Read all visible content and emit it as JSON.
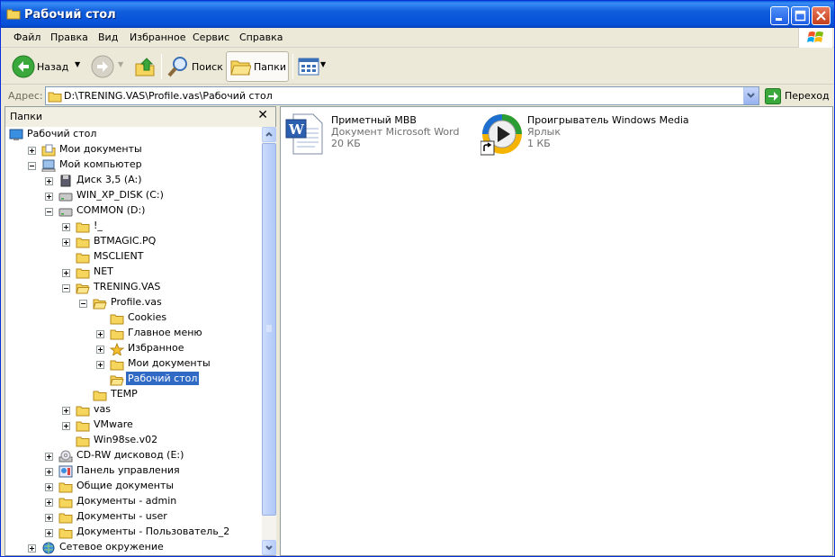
{
  "window": {
    "title": "Рабочий стол"
  },
  "menu": [
    "Файл",
    "Правка",
    "Вид",
    "Избранное",
    "Сервис",
    "Справка"
  ],
  "toolbar": {
    "back": "Назад",
    "search": "Поиск",
    "folders": "Папки"
  },
  "address": {
    "label": "Адрес:",
    "value": "D:\\TRENING.VAS\\Profile.vas\\Рабочий стол",
    "go": "Переход"
  },
  "folders_pane": {
    "title": "Папки"
  },
  "tree": [
    {
      "label": "Рабочий стол",
      "icon": "desktop-icon",
      "level": 0,
      "toggle": "none"
    },
    {
      "label": "Мои документы",
      "icon": "my-documents-icon",
      "level": 1,
      "toggle": "plus"
    },
    {
      "label": "Мой компьютер",
      "icon": "my-computer-icon",
      "level": 1,
      "toggle": "minus"
    },
    {
      "label": "Диск 3,5 (A:)",
      "icon": "floppy-icon",
      "level": 2,
      "toggle": "plus"
    },
    {
      "label": "WIN_XP_DISK (C:)",
      "icon": "drive-icon",
      "level": 2,
      "toggle": "plus"
    },
    {
      "label": "COMMON (D:)",
      "icon": "drive-icon",
      "level": 2,
      "toggle": "minus"
    },
    {
      "label": "!_",
      "icon": "folder-icon",
      "level": 3,
      "toggle": "plus"
    },
    {
      "label": "BTMAGIC.PQ",
      "icon": "folder-icon",
      "level": 3,
      "toggle": "plus"
    },
    {
      "label": "MSCLIENT",
      "icon": "folder-icon",
      "level": 3,
      "toggle": "none"
    },
    {
      "label": "NET",
      "icon": "folder-icon",
      "level": 3,
      "toggle": "plus"
    },
    {
      "label": "TRENING.VAS",
      "icon": "folder-open-icon",
      "level": 3,
      "toggle": "minus"
    },
    {
      "label": "Profile.vas",
      "icon": "folder-open-icon",
      "level": 4,
      "toggle": "minus"
    },
    {
      "label": "Cookies",
      "icon": "folder-icon",
      "level": 5,
      "toggle": "none"
    },
    {
      "label": "Главное меню",
      "icon": "folder-icon",
      "level": 5,
      "toggle": "plus"
    },
    {
      "label": "Избранное",
      "icon": "star-icon",
      "level": 5,
      "toggle": "plus"
    },
    {
      "label": "Мои документы",
      "icon": "folder-icon",
      "level": 5,
      "toggle": "plus"
    },
    {
      "label": "Рабочий стол",
      "icon": "folder-open-icon",
      "level": 5,
      "toggle": "none",
      "selected": true
    },
    {
      "label": "TEMP",
      "icon": "folder-icon",
      "level": 4,
      "toggle": "none"
    },
    {
      "label": "vas",
      "icon": "folder-icon",
      "level": 3,
      "toggle": "plus"
    },
    {
      "label": "VMware",
      "icon": "folder-icon",
      "level": 3,
      "toggle": "plus"
    },
    {
      "label": "Win98se.v02",
      "icon": "folder-icon",
      "level": 3,
      "toggle": "none"
    },
    {
      "label": "CD-RW дисковод (E:)",
      "icon": "cdrom-icon",
      "level": 2,
      "toggle": "plus"
    },
    {
      "label": "Панель управления",
      "icon": "control-panel-icon",
      "level": 2,
      "toggle": "plus"
    },
    {
      "label": "Общие документы",
      "icon": "folder-icon",
      "level": 2,
      "toggle": "plus"
    },
    {
      "label": "Документы - admin",
      "icon": "folder-icon",
      "level": 2,
      "toggle": "plus"
    },
    {
      "label": "Документы - user",
      "icon": "folder-icon",
      "level": 2,
      "toggle": "plus"
    },
    {
      "label": "Документы - Пользователь_2",
      "icon": "folder-icon",
      "level": 2,
      "toggle": "plus"
    },
    {
      "label": "Сетевое окружение",
      "icon": "network-icon",
      "level": 1,
      "toggle": "plus"
    }
  ],
  "files": [
    {
      "name": "Приметный МВВ",
      "type": "Документ Microsoft Word",
      "size": "20 КБ",
      "icon": "word-document-icon"
    },
    {
      "name": "Проигрыватель Windows Media",
      "type": "Ярлык",
      "size": "1 КБ",
      "icon": "media-player-shortcut-icon"
    }
  ],
  "colors": {
    "titlebar": "#0650d8",
    "selection": "#316ac5",
    "folder": "#f6d55c",
    "chrome": "#ece9d8"
  }
}
